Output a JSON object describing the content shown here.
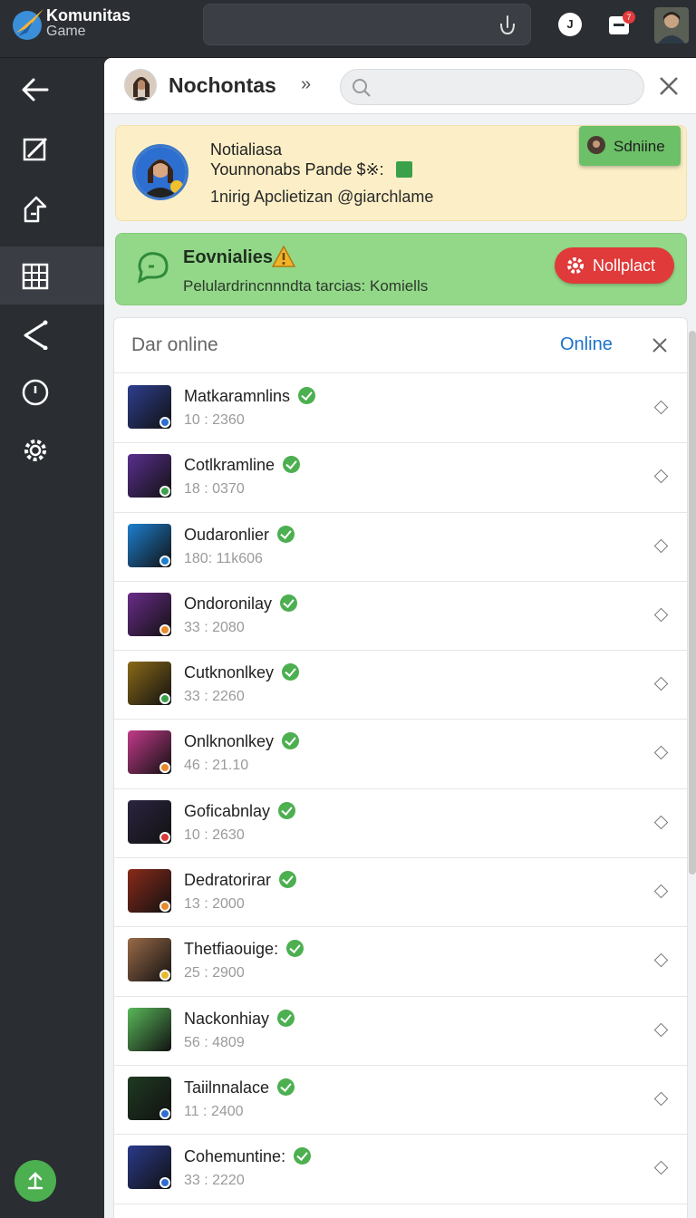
{
  "topbar": {
    "brand_name": "Komunitas",
    "brand_sub": "Game",
    "search_placeholder": "",
    "profile_initial": "J",
    "messages_badge": "7"
  },
  "sidebar": {
    "items": [
      "back-arrow-icon",
      "edit-icon",
      "share-icon",
      "grid-icon",
      "network-icon",
      "clock-icon",
      "settings-icon"
    ],
    "active_index": 3
  },
  "header": {
    "title": "Nochontas",
    "chevron": "»",
    "search_placeholder": ""
  },
  "notice": {
    "line1": "Notialiasa",
    "line2": "Younnonabs Pande $※:",
    "line3": "1nirig Apclietizan @giarchlame",
    "button_label": "Sdniine"
  },
  "alert": {
    "title": "Eovnialies",
    "text": "Pelulardrincnnndta tarcias: Komiells",
    "button_label": "Nollplact"
  },
  "list": {
    "title": "Dar online",
    "filter_label": "Online",
    "rows": [
      {
        "name": "Matkaramnlins",
        "stat": "10 :  2360",
        "color": "#2e3f8f",
        "dot": "#2f6fd1"
      },
      {
        "name": "Cotlkramline",
        "stat": "18 :  0370",
        "color": "#5a2f8f",
        "dot": "#3aa14a"
      },
      {
        "name": "Oudaronlier",
        "stat": "180: 11k606",
        "color": "#1d7fd0",
        "dot": "#1d7fd0"
      },
      {
        "name": "Ondoronilay",
        "stat": "33 :  2080",
        "color": "#6a2c8a",
        "dot": "#e8892a"
      },
      {
        "name": "Cutknonlkey",
        "stat": "33 :  2260",
        "color": "#8a6a18",
        "dot": "#3aa14a"
      },
      {
        "name": "Onlknonlkey",
        "stat": "46 :  21.10",
        "color": "#c23a8a",
        "dot": "#e8892a"
      },
      {
        "name": "Goficabnlay",
        "stat": "10 :  2630",
        "color": "#2b2440",
        "dot": "#d93a3a"
      },
      {
        "name": "Dedratorirar",
        "stat": "13 :  2000",
        "color": "#8a2a1a",
        "dot": "#e8892a"
      },
      {
        "name": "Thetfiaouige:",
        "stat": "25 :  2900",
        "color": "#9a6a48",
        "dot": "#e8b92a"
      },
      {
        "name": "Nackonhiay",
        "stat": "56 :  4809",
        "color": "#5ab85a",
        "dot": ""
      },
      {
        "name": "Taiilnnalace",
        "stat": "11 :  2400",
        "color": "#1f3a22",
        "dot": "#2f6fd1"
      },
      {
        "name": "Cohemuntine:",
        "stat": "33 :  2220",
        "color": "#2a3a8a",
        "dot": "#2f6fd1"
      }
    ]
  }
}
